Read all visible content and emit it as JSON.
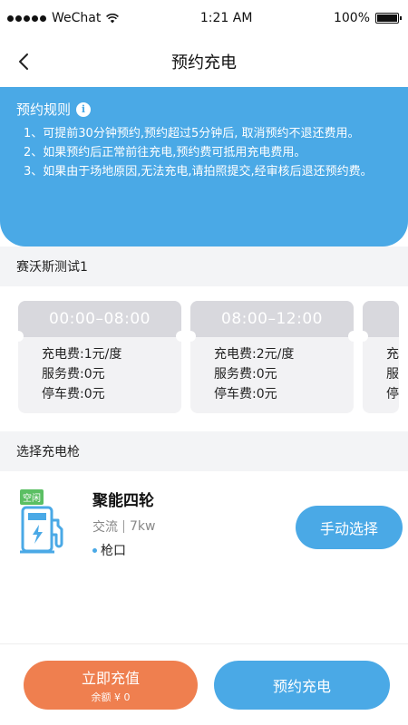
{
  "status_bar": {
    "carrier": "WeChat",
    "time": "1:21 AM",
    "battery": "100%"
  },
  "nav": {
    "title": "预约充电"
  },
  "rules": {
    "title": "预约规则",
    "items": [
      {
        "num": "1、",
        "text": "可提前30分钟预约,预约超过5分钟后, 取消预约不退还费用。"
      },
      {
        "num": "2、",
        "text": "如果预约后正常前往充电,预约费可抵用充电费用。"
      },
      {
        "num": "3、",
        "text": "如果由于场地原因,无法充电,请拍照提交,经审核后退还预约费。"
      }
    ]
  },
  "station": {
    "name": "赛沃斯测试1"
  },
  "time_slots": [
    {
      "time": "00:00–08:00",
      "charge_fee": "充电费:1元/度",
      "service_fee": "服务费:0元",
      "parking_fee": "停车费:0元"
    },
    {
      "time": "08:00–12:00",
      "charge_fee": "充电费:2元/度",
      "service_fee": "服务费:0元",
      "parking_fee": "停车费:0元"
    },
    {
      "time": "",
      "charge_fee": "充",
      "service_fee": "服",
      "parking_fee": "停"
    }
  ],
  "gun_section": {
    "title": "选择充电枪"
  },
  "connector": {
    "status": "空闲",
    "name": "聚能四轮",
    "current_type": "交流",
    "power": "7kw",
    "port": "枪口",
    "manual_button": "手动选择"
  },
  "bottom": {
    "recharge_label": "立即充值",
    "balance_label": "余额 ¥ 0",
    "reserve_label": "预约充电"
  },
  "colors": {
    "primary": "#4aa9e6",
    "orange": "#ef7f4f",
    "idle_green": "#5bbf63"
  }
}
